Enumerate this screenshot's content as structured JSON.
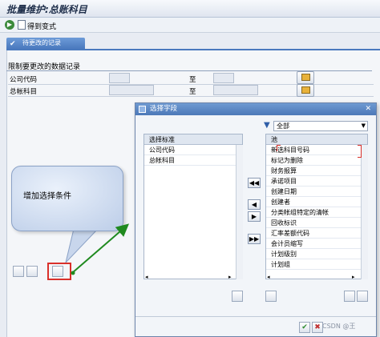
{
  "window": {
    "title": "批量维护:总账科目"
  },
  "toolbar": {
    "get_variant_label": "得到变式"
  },
  "tabs": [
    {
      "label": "待更改的记录"
    }
  ],
  "criteria": {
    "group_title": "限制要更改的数据记录",
    "to_label": "至",
    "fields": [
      {
        "label": "公司代码",
        "from_value": "",
        "to_value": ""
      },
      {
        "label": "总帐科目",
        "from_value": "",
        "to_value": ""
      }
    ]
  },
  "callout": {
    "text": "增加选择条件"
  },
  "dialog": {
    "title": "选择字段",
    "filter_value": "全部",
    "left_list": {
      "header": "选择标准",
      "items": [
        "公司代码",
        "总帐科目"
      ]
    },
    "right_list": {
      "header": "池",
      "items": [
        "新选科目号码",
        "标记为删除",
        "财务报算",
        "承诺项目",
        "创建日期",
        "创建者",
        "分类帐组特定的清帐",
        "回收标识",
        "汇率差额代码",
        "会计员缩写",
        "计划级别",
        "计划组"
      ]
    },
    "move_buttons": [
      "◀◀",
      "◀",
      "▶",
      "▶▶"
    ]
  },
  "watermark": "CSDN @王"
}
